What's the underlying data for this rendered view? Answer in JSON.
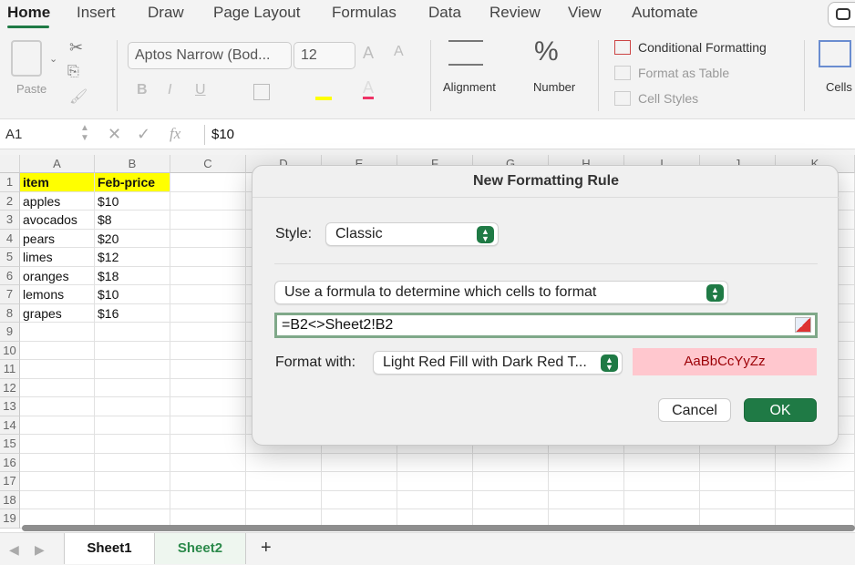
{
  "ribbon_tabs": [
    "Home",
    "Insert",
    "Draw",
    "Page Layout",
    "Formulas",
    "Data",
    "Review",
    "View",
    "Automate"
  ],
  "ribbon": {
    "paste_label": "Paste",
    "font_name": "Aptos Narrow (Bod...",
    "font_size": "12",
    "bold": "B",
    "italic": "I",
    "underline": "U",
    "alignment_label": "Alignment",
    "number_label": "Number",
    "conditional_formatting": "Conditional Formatting",
    "format_as_table": "Format as Table",
    "cell_styles": "Cell Styles",
    "cells_label": "Cells"
  },
  "formula_bar": {
    "name_box": "A1",
    "fx": "fx",
    "value": "$10"
  },
  "grid": {
    "columns": [
      "A",
      "B",
      "C",
      "D",
      "E",
      "F",
      "G",
      "H",
      "I",
      "J",
      "K"
    ],
    "rows": [
      "1",
      "2",
      "3",
      "4",
      "5",
      "6",
      "7",
      "8",
      "9",
      "10",
      "11",
      "12",
      "13",
      "14",
      "15",
      "16",
      "17",
      "18",
      "19"
    ],
    "data": [
      [
        "item",
        "Feb-price"
      ],
      [
        "apples",
        "$10"
      ],
      [
        "avocados",
        "$8"
      ],
      [
        "pears",
        "$20"
      ],
      [
        "limes",
        "$12"
      ],
      [
        "oranges",
        "$18"
      ],
      [
        "lemons",
        "$10"
      ],
      [
        "grapes",
        "$16"
      ]
    ]
  },
  "sheets": [
    "Sheet1",
    "Sheet2"
  ],
  "dialog": {
    "title": "New Formatting Rule",
    "style_label": "Style:",
    "style_value": "Classic",
    "rule_type": "Use a formula to determine which cells to format",
    "formula": "=B2<>Sheet2!B2",
    "format_with_label": "Format with:",
    "format_with_value": "Light Red Fill with Dark Red T...",
    "preview_text": "AaBbCcYyZz",
    "cancel_label": "Cancel",
    "ok_label": "OK"
  },
  "colors": {
    "accent_green": "#1f7a45",
    "header_fill": "#ffff00",
    "preview_fill": "#ffc7ce",
    "preview_text": "#9c0006"
  }
}
